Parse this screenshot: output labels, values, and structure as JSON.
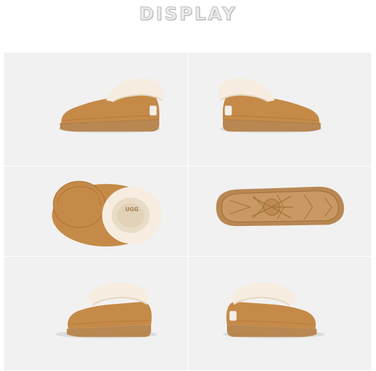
{
  "header": {
    "title": "DISPLAY"
  },
  "gallery": {
    "images": [
      {
        "view": "side-left"
      },
      {
        "view": "side-right"
      },
      {
        "view": "top"
      },
      {
        "view": "sole"
      },
      {
        "view": "angle-left"
      },
      {
        "view": "angle-right"
      }
    ]
  },
  "colors": {
    "suede": "#c58a48",
    "suede_dark": "#a96e33",
    "fur": "#f6ede0",
    "sole": "#b88752",
    "background": "#f1f1f1"
  }
}
